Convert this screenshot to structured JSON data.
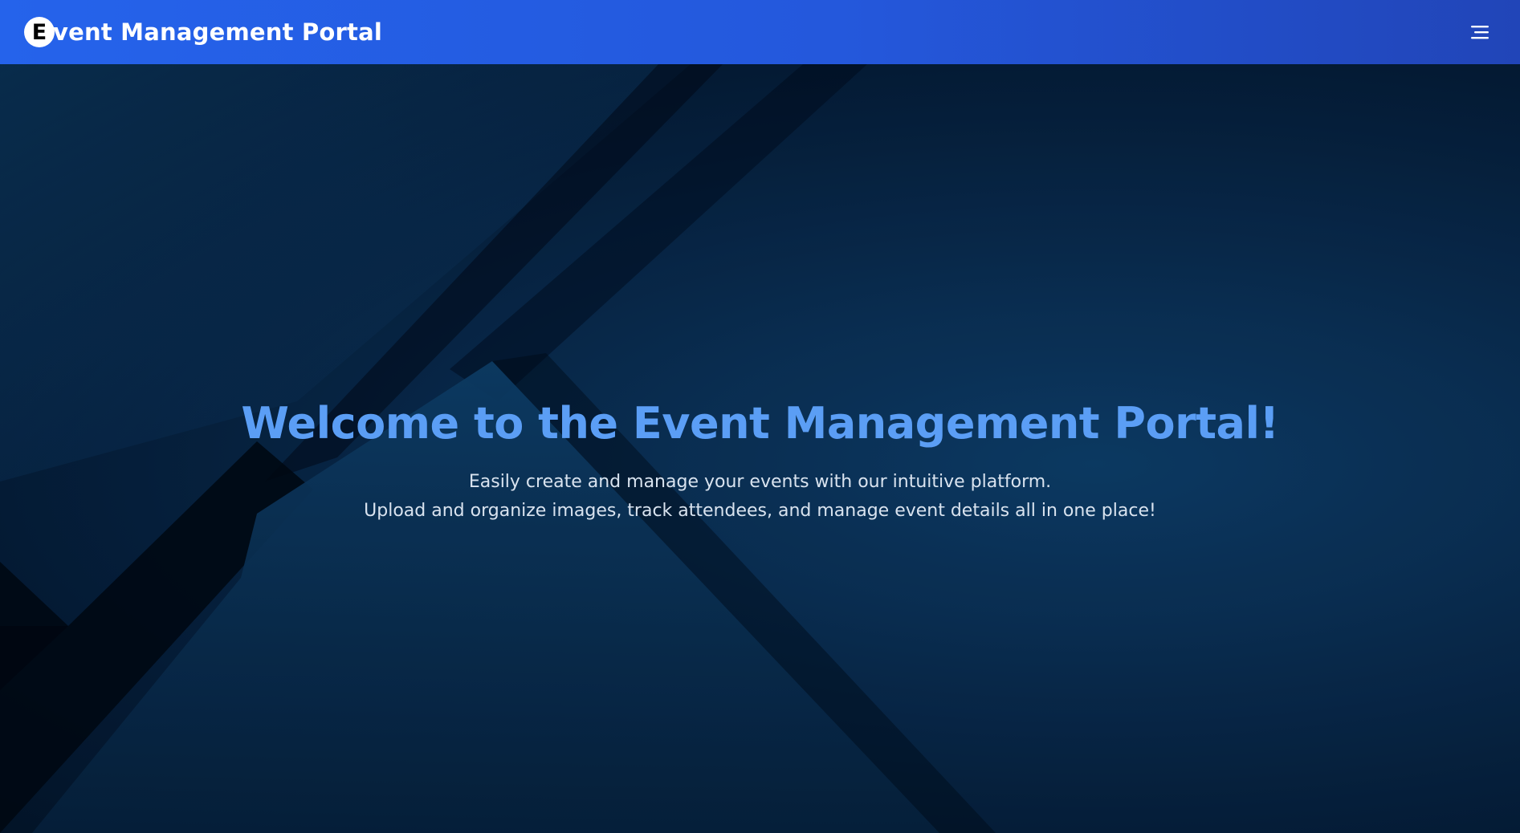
{
  "header": {
    "logo_letter": "E",
    "brand_title": "vent Management Portal",
    "menu_icon": "hamburger-menu-icon",
    "colors": {
      "start": "#2563eb",
      "end": "#2145b8"
    }
  },
  "hero": {
    "title": "Welcome to the Event Management Portal!",
    "subtitle_line1": "Easily create and manage your events with our intuitive platform.",
    "subtitle_line2": "Upload and organize images, track attendees, and manage event details all in one place!",
    "title_color": "#5b9ef5",
    "background_color": "#06213f"
  }
}
